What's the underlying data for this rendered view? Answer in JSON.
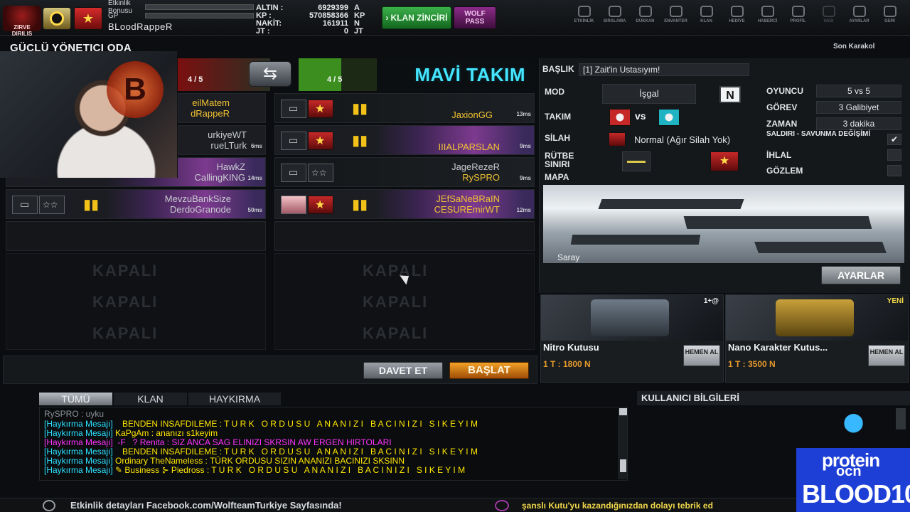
{
  "topbar": {
    "game_logo": "ZIRVE DIRILIS",
    "xp_labels": [
      "Etkinlik Bonusu",
      "GP"
    ],
    "player_name": "BLoodRappeR",
    "currencies": [
      {
        "key": "ALTIN :",
        "value": "6929399",
        "unit": "A"
      },
      {
        "key": "KP :",
        "value": "570858366",
        "unit": "KP"
      },
      {
        "key": "NAKİT:",
        "value": "161911",
        "unit": "N"
      },
      {
        "key": "JT :",
        "value": "0",
        "unit": "JT"
      }
    ],
    "klan_button": "KLAN ZİNCİRİ",
    "wolf_button": "WOLF PASS",
    "nav": [
      {
        "label": "ETKİNLİK",
        "icon": "clock-icon"
      },
      {
        "label": "SIRALAMA",
        "icon": "wolf-icon"
      },
      {
        "label": "DÜKKAN",
        "icon": "cart-icon"
      },
      {
        "label": "ENVANTER",
        "icon": "inventory-icon"
      },
      {
        "label": "KLAN",
        "icon": "clan-icon"
      },
      {
        "label": "HEDİYE",
        "icon": "gift-icon"
      },
      {
        "label": "HABERCİ",
        "icon": "megaphone-icon"
      },
      {
        "label": "PROFİL",
        "icon": "profile-icon"
      },
      {
        "label": "WEB",
        "icon": "web-icon"
      },
      {
        "label": "AYARLAR",
        "icon": "gear-icon"
      },
      {
        "label": "GERİ",
        "icon": "back-icon"
      }
    ]
  },
  "room": {
    "title": "GÜÇLÜ YÖNETICI ODA",
    "right_title": "Son Karakol"
  },
  "teams": {
    "red": {
      "count": "4 / 5",
      "players": [
        {
          "name": "eilMatem",
          "name2": "dRappeR",
          "ms": ""
        },
        {
          "name": "urkiyeWT",
          "name2": "rueLTurk",
          "ms": "6ms"
        },
        {
          "name": "HawkZ",
          "name2": "CallingKING",
          "ms": "14ms"
        },
        {
          "name": "MevzuBankSize",
          "name2": "DerdoGranode",
          "ms": "50ms"
        }
      ]
    },
    "blue": {
      "name": "MAVİ TAKIM",
      "count": "4 / 5",
      "players": [
        {
          "name": "JaxionGG",
          "name2": "",
          "ms": "13ms"
        },
        {
          "name": "IIIALPARSLAN",
          "name2": "",
          "ms": "9ms"
        },
        {
          "name": "JageRezeR",
          "name2": "RySPRO",
          "ms": "9ms"
        },
        {
          "name": "JEfSaNeBRaIN",
          "name2": "CESUREmirWT",
          "ms": "12ms"
        }
      ]
    },
    "closed_label": "KAPALI",
    "swap_icon": "swap-icon"
  },
  "buttons": {
    "invite": "DAVET ET",
    "start": "BAŞLAT",
    "settings": "AYARLAR"
  },
  "settings": {
    "title_label": "BAŞLIK",
    "title_value": "[1] Zait'in Ustasıyım!",
    "mode_label": "MOD",
    "mode_value": "İşgal",
    "mode_tag": "N",
    "team_label": "TAKIM",
    "team_vs": "vs",
    "weapon_label": "SİLAH",
    "weapon_value": "Normal (Ağır Silah Yok)",
    "rank_label": "RÜTBE SINIRI",
    "map_label": "MAPA",
    "map_name": "Saray",
    "right": [
      {
        "label": "OYUNCU",
        "value": "5 vs 5"
      },
      {
        "label": "GÖREV",
        "value": "3 Galibiyet"
      },
      {
        "label": "ZAMAN",
        "value": "3 dakika"
      }
    ],
    "toggles": [
      {
        "label": "SALDIRI - SAVUNMA DEĞİŞİMİ",
        "checked": "✔"
      },
      {
        "label": "İHLAL",
        "checked": ""
      },
      {
        "label": "GÖZLEM",
        "checked": ""
      }
    ]
  },
  "shop": [
    {
      "title": "Nitro Kutusu",
      "price": "1 T : 1800 N",
      "buy": "HEMEN AL",
      "tag": "1+@"
    },
    {
      "title": "Nano Karakter Kutus...",
      "price": "1 T : 3500 N",
      "buy": "HEMEN AL",
      "tag": "YENİ"
    }
  ],
  "chat": {
    "tabs": [
      "TÜMÜ",
      "KLAN",
      "HAYKIRMA"
    ],
    "lines": [
      {
        "prefix": "RySPRO : uyku",
        "body": ""
      },
      {
        "prefix": "[Haykırma Mesajı]",
        "body": "BENDEN INSAFDILEME : T U R K   O R D U S U   A N A N I Z I   B A C I N I Z I   S I K E Y I M"
      },
      {
        "prefix": "[Haykırma Mesajı]",
        "body": "KaPgAm : ananızı s1keyim"
      },
      {
        "prefix": "[Haykırma Mesajı]",
        "body": "-F   ? Renita : SIZ ANCA SAG ELINIZI SKRSIN AW ERGEN HIRTOLARI"
      },
      {
        "prefix": "[Haykırma Mesajı]",
        "body": "BENDEN INSAFDILEME : T U R K   O R D U S U   A N A N I Z I   B A C I N I Z I   S I K E Y I M"
      },
      {
        "prefix": "[Haykırma Mesajı]",
        "body": "Ordinary TheNameless : TÜRK ORDUSU SIZIN ANANIZI BACINIZI SKSINN"
      },
      {
        "prefix": "[Haykırma Mesajı]",
        "body": "✎ Business ⊱ Piedross : T U R K   O R D U S U   A N A N I Z I   B A C I N I Z I   S I K E Y I M"
      }
    ]
  },
  "user_info_title": "KULLANICI BİLGİLERİ",
  "promo": {
    "line1": "protein",
    "line2": "ocn",
    "line3": "BLOOD10"
  },
  "footer": {
    "left": "Etkinlik detayları Facebook.com/WolfteamTurkiye Sayfasında!",
    "right": "şanslı Kutu'yu kazandığınızdan dolayı tebrik ed"
  }
}
